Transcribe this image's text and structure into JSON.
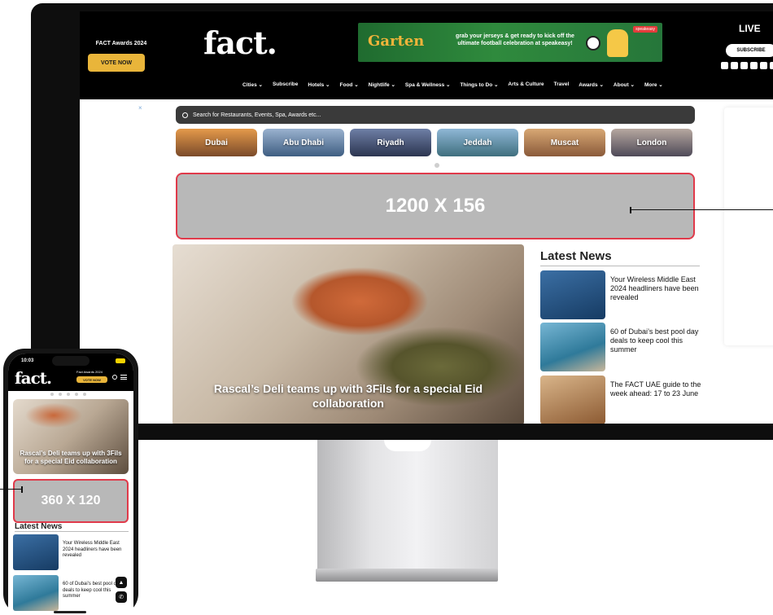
{
  "desktop": {
    "header": {
      "awards_label": "FACT Awards 2024",
      "vote_button": "VOTE NOW",
      "logo": "fact.",
      "live_label": "LIVE",
      "subscribe_button": "SUBSCRIBE"
    },
    "banner_ad": {
      "brand": "Garten",
      "promo_text": "grab your jerseys & get ready to kick off the ultimate football celebration at speakeasy!",
      "tag": "speakeasy"
    },
    "nav": [
      "Cities ⌄",
      "Subscribe",
      "Hotels ⌄",
      "Food ⌄",
      "Nightlife ⌄",
      "Spa & Wellness ⌄",
      "Things to Do ⌄",
      "Arts & Culture",
      "Travel",
      "Awards ⌄",
      "About ⌄",
      "More ⌄"
    ],
    "search_placeholder": "Search for Restaurants, Events, Spa, Awards etc...",
    "cities": [
      "Dubai",
      "Abu Dhabi",
      "Riyadh",
      "Jeddah",
      "Muscat",
      "London"
    ],
    "ad_close": "×",
    "big_ad_label": "1200 X 156",
    "hero_title": "Rascal’s Deli teams up with 3Fils for a special Eid collaboration",
    "latest_heading": "Latest News",
    "latest_news": [
      "Your Wireless Middle East 2024 headliners have been revealed",
      "60 of Dubai’s best pool day deals to keep cool this summer",
      "The FACT UAE guide to the week ahead: 17 to 23 June"
    ]
  },
  "mobile": {
    "time": "10:03",
    "logo": "fact.",
    "awards_label": "Fact Awards 2024",
    "vote_button": "VOTE NOW",
    "hero_title": "Rascal’s Deli teams up with 3Fils for a special Eid collaboration",
    "ad_label": "360 X 120",
    "latest_heading": "Latest News",
    "latest_news": [
      "Your Wireless Middle East 2024 headliners have been revealed",
      "60 of Dubai’s best pool day deals to keep cool this summer"
    ]
  },
  "colors": {
    "vote_button": "#e9b53a",
    "ad_border": "#e03a4a",
    "ad_fill": "#b8b8b8",
    "header_bg": "#000000"
  },
  "icons": [
    "search-icon",
    "menu-icon",
    "instagram-icon",
    "tiktok-icon",
    "youtube-icon",
    "facebook-icon",
    "whatsapp-icon",
    "bell-icon"
  ]
}
